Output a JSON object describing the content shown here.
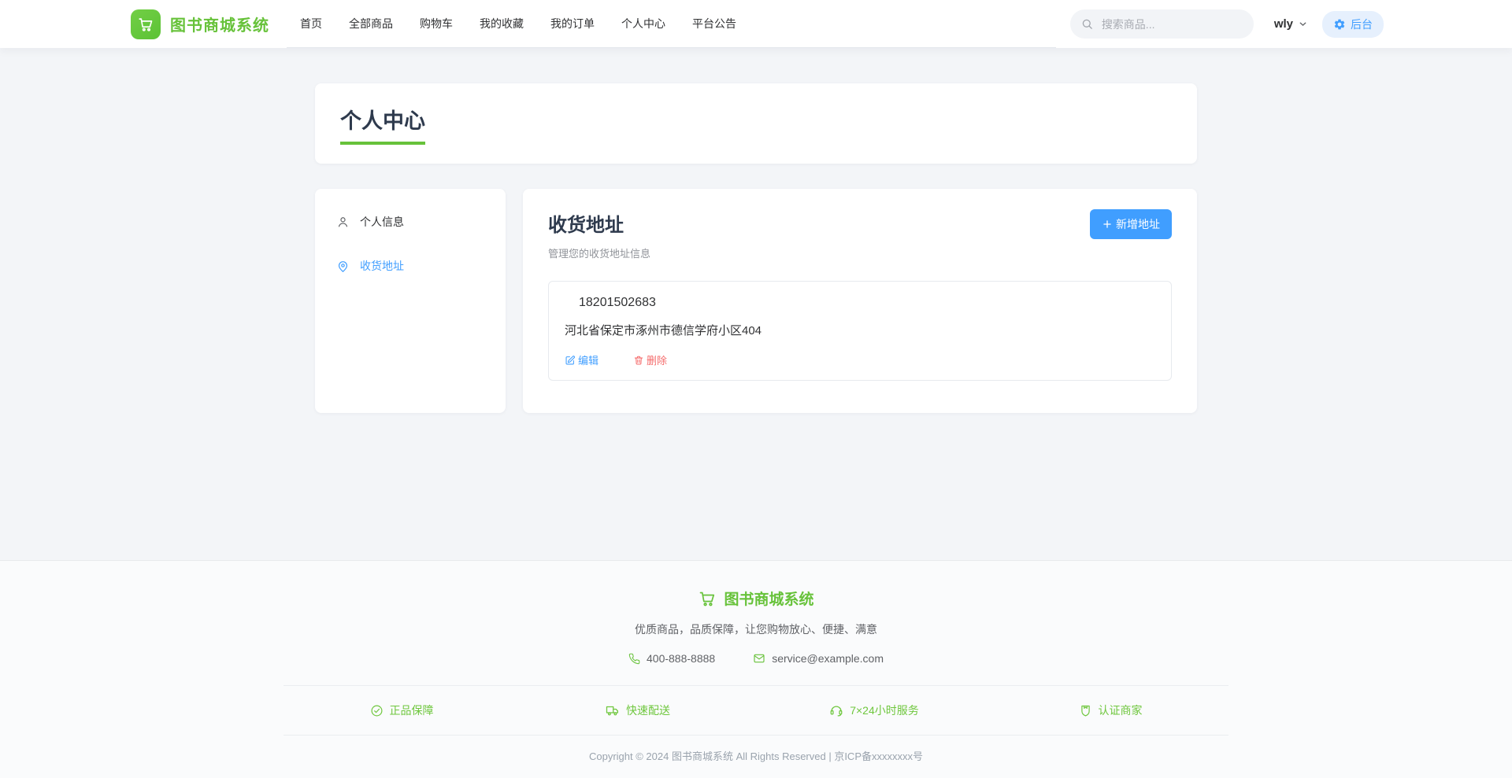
{
  "brand": {
    "name": "图书商城系统",
    "color": "#67c23a",
    "logo_icon": "cart-icon"
  },
  "header": {
    "nav": [
      "首页",
      "全部商品",
      "购物车",
      "我的收藏",
      "我的订单",
      "个人中心",
      "平台公告"
    ],
    "search": {
      "placeholder": "搜索商品...",
      "icon": "search-icon"
    },
    "username": "wly",
    "user_dropdown_icon": "chevron-down-icon",
    "admin_button": {
      "label": "后台",
      "icon": "gear-icon",
      "bg": "#e6f0fd",
      "color": "#409eff"
    }
  },
  "page": {
    "title": "个人中心"
  },
  "sidebar": {
    "items": [
      {
        "label": "个人信息",
        "icon": "user-icon",
        "active": false
      },
      {
        "label": "收货地址",
        "icon": "location-icon",
        "active": true
      }
    ]
  },
  "address_section": {
    "title": "收货地址",
    "subtitle": "管理您的收货地址信息",
    "add_button": {
      "label": "新增地址",
      "icon": "plus-icon",
      "bg": "#409eff"
    },
    "addresses": [
      {
        "phone": "18201502683",
        "address": "河北省保定市涿州市德信学府小区404",
        "edit_label": "编辑",
        "delete_label": "删除"
      }
    ]
  },
  "footer": {
    "brand": "图书商城系统",
    "tagline": "优质商品，品质保障，让您购物放心、便捷、满意",
    "phone": "400-888-8888",
    "email": "service@example.com",
    "features": [
      {
        "label": "正品保障",
        "icon": "check-circle-icon"
      },
      {
        "label": "快速配送",
        "icon": "truck-icon"
      },
      {
        "label": "7×24小时服务",
        "icon": "headset-icon"
      },
      {
        "label": "认证商家",
        "icon": "badge-icon"
      }
    ],
    "copyright": "Copyright © 2024 图书商城系统 All Rights Reserved | 京ICP备xxxxxxxx号"
  },
  "colors": {
    "brand_green": "#67c23a",
    "link_blue": "#409eff",
    "danger_red": "#f56c6c",
    "heading": "#2e3a4d",
    "muted": "#909399",
    "page_bg": "#f3f5f8"
  }
}
